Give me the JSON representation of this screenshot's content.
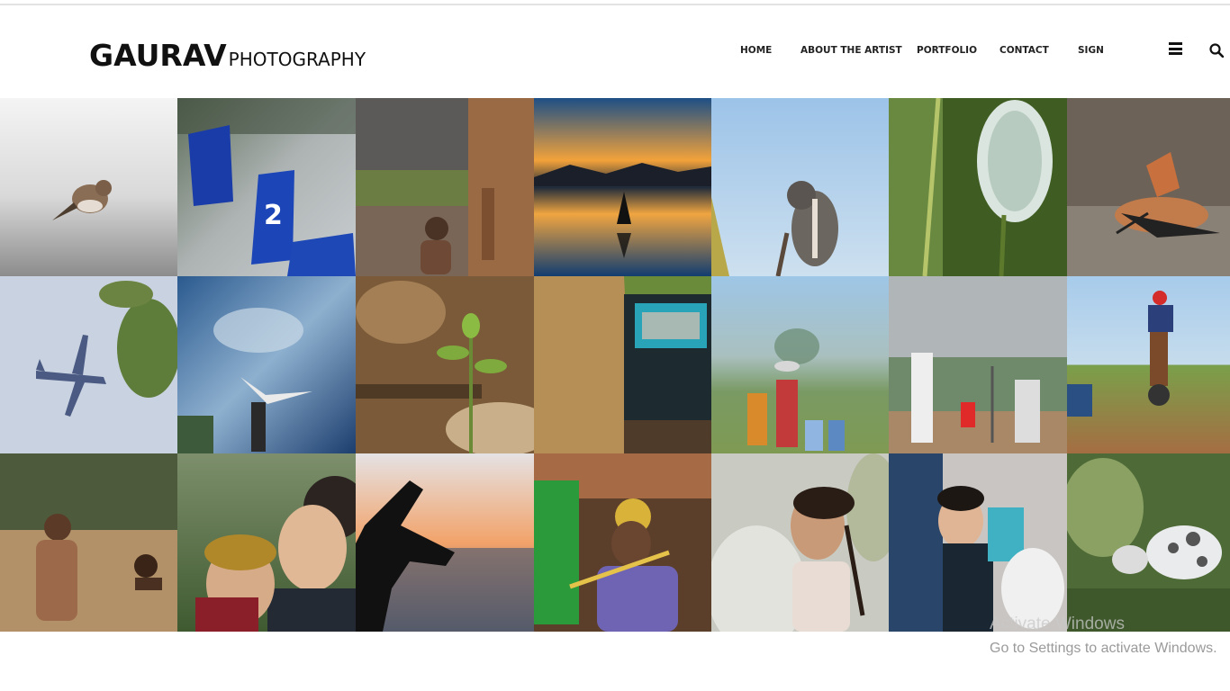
{
  "brand": {
    "main": "GAURAV",
    "sub": "PHOTOGRAPHY"
  },
  "nav": {
    "home": "HOME",
    "about": "ABOUT THE ARTIST",
    "portfolio": "PORTFOLIO",
    "contact": "CONTACT",
    "sign": "SIGN"
  },
  "icons": {
    "menu": "hamburger-menu-icon",
    "search": "search-icon"
  },
  "gallery": {
    "photos": [
      "bird-on-ground",
      "blue-number-markers",
      "child-and-cattle",
      "sunset-yoga-reflection",
      "squirrel-on-stick",
      "white-flower-buds",
      "hoopoe-bird",
      "airplane-in-sky",
      "heron-in-flight",
      "seedling-in-soil",
      "truck-in-field",
      "village-children",
      "street-cricket",
      "motorbike-jump",
      "boys-in-river",
      "wedding-couple",
      "hand-at-sunset",
      "flute-player",
      "smiling-girl",
      "child-in-crowd",
      "cat-in-grass"
    ]
  },
  "watermark": {
    "title": "Activate Windows",
    "subtitle": "Go to Settings to activate Windows."
  }
}
